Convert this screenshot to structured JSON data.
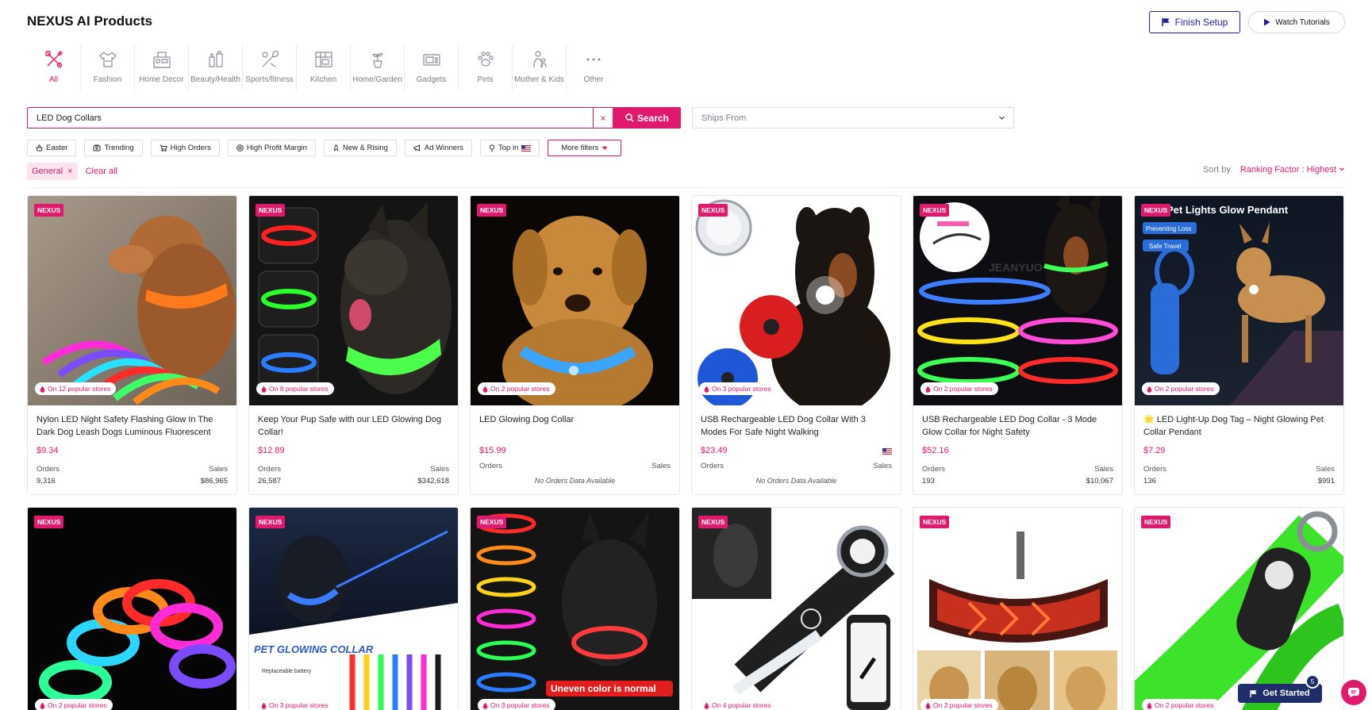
{
  "header": {
    "title": "NEXUS AI Products",
    "finish_setup": "Finish Setup",
    "watch_tutorials": "Watch Tutorials"
  },
  "categories": [
    {
      "label": "All",
      "icon": "tools-icon",
      "active": true
    },
    {
      "label": "Fashion",
      "icon": "shirt-icon"
    },
    {
      "label": "Home Decor",
      "icon": "home-decor-icon"
    },
    {
      "label": "Beauty/Health",
      "icon": "beauty-icon"
    },
    {
      "label": "Sports/fitness",
      "icon": "sports-icon"
    },
    {
      "label": "Kitchen",
      "icon": "kitchen-icon"
    },
    {
      "label": "Home/Garden",
      "icon": "plant-icon"
    },
    {
      "label": "Gadgets",
      "icon": "gadgets-icon"
    },
    {
      "label": "Pets",
      "icon": "paw-icon"
    },
    {
      "label": "Mother & Kids",
      "icon": "mother-kids-icon"
    },
    {
      "label": "Other",
      "icon": "more-dots-icon"
    }
  ],
  "search": {
    "value": "LED Dog Collars",
    "clear": "×",
    "button": "Search",
    "ships_from_placeholder": "Ships From"
  },
  "filters": [
    {
      "label": "Easter",
      "icon": "basket-icon"
    },
    {
      "label": "Trending",
      "icon": "trending-icon"
    },
    {
      "label": "High Orders",
      "icon": "cart-icon"
    },
    {
      "label": "High Profit Margin",
      "icon": "coin-icon"
    },
    {
      "label": "New & Rising",
      "icon": "rocket-icon"
    },
    {
      "label": "Ad Winners",
      "icon": "megaphone-icon"
    },
    {
      "label": "Top in",
      "icon": "pin-icon",
      "flag": "us-flag-icon"
    }
  ],
  "more_filters": "More filters",
  "active_filter": {
    "label": "General",
    "remove": "×"
  },
  "clear_all": "Clear all",
  "sort": {
    "label": "Sort by",
    "value": "Ranking Factor : Highest"
  },
  "product_labels": {
    "badge": "NEXUS",
    "orders": "Orders",
    "sales": "Sales",
    "no_data": "No Orders Data Available"
  },
  "products": [
    {
      "title": "Nylon LED Night Safety Flashing Glow In The Dark Dog Leash Dogs Luminous Fluorescent",
      "price": "$9.34",
      "stores": "On 12 popular stores",
      "orders": "9,316",
      "sales": "$86,965"
    },
    {
      "title": "Keep Your Pup Safe with our LED Glowing Dog Collar!",
      "price": "$12.89",
      "stores": "On 8 popular stores",
      "orders": "26,587",
      "sales": "$342,618"
    },
    {
      "title": "LED Glowing Dog Collar",
      "price": "$15.99",
      "stores": "On 2 popular stores",
      "orders": "",
      "sales": ""
    },
    {
      "title": "USB Rechargeable LED Dog Collar With 3 Modes For Safe Night Walking",
      "price": "$23.49",
      "stores": "On 3 popular stores",
      "orders": "",
      "sales": ""
    },
    {
      "title": "USB Rechargeable LED Dog Collar - 3 Mode Glow Collar for Night Safety",
      "price": "$52.16",
      "stores": "On 2 popular stores",
      "orders": "193",
      "sales": "$10,067"
    },
    {
      "title": "🌟 LED Light-Up Dog Tag – Night Glowing Pet Collar Pendant",
      "price": "$7.29",
      "stores": "On 2 popular stores",
      "orders": "136",
      "sales": "$991"
    },
    {
      "stores": "On 2 popular stores"
    },
    {
      "stores": "On 3 popular stores"
    },
    {
      "stores": "On 3 popular stores"
    },
    {
      "stores": "On 4 popular stores"
    },
    {
      "stores": "On 2 popular stores"
    },
    {
      "stores": "On 2 popular stores"
    }
  ],
  "image_text": {
    "pendant_heading": "Pet Lights Glow Pendant",
    "pendant_tag1": "Preventing Loss",
    "pendant_tag2": "Safe Travel",
    "watermark": "JEANYUO",
    "glowing_heading": "PET GLOWING COLLAR",
    "glowing_feature": "Replaceable battery",
    "uneven": "Uneven color is normal"
  },
  "widgets": {
    "get_started": "Get Started",
    "get_started_count": "5"
  },
  "colors": {
    "accent": "#e0196d",
    "navy": "#1e1ea8",
    "widget": "#1f2d6b"
  }
}
